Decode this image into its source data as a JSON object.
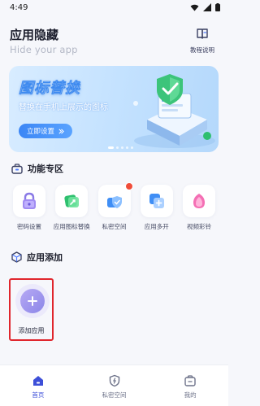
{
  "status_bar": {
    "time": "4:49"
  },
  "header": {
    "title": "应用隐藏",
    "subtitle": "Hide your app",
    "tutorial_label": "教程说明"
  },
  "banner": {
    "title": "图标替换",
    "description": "替换在手机上展示的图标",
    "button_label": "立即设置",
    "dot_count": 5,
    "active_dot": 0
  },
  "features_section": {
    "title": "功能专区",
    "items": [
      {
        "label": "密码设置",
        "icon": "lock-icon"
      },
      {
        "label": "应用图标替换",
        "icon": "image-icon"
      },
      {
        "label": "私密空间",
        "icon": "shield-icon",
        "badge": true
      },
      {
        "label": "应用多开",
        "icon": "plus-icon"
      },
      {
        "label": "视频彩铃",
        "icon": "bell-icon"
      }
    ]
  },
  "apps_section": {
    "title": "应用添加",
    "add_label": "添加应用"
  },
  "bottom_nav": [
    {
      "label": "首页",
      "icon": "home-icon",
      "active": true
    },
    {
      "label": "私密空间",
      "icon": "shield-icon",
      "active": false
    },
    {
      "label": "我的",
      "icon": "profile-icon",
      "active": false
    }
  ],
  "colors": {
    "accent": "#3d4fd8",
    "banner_button": "#3b86f5",
    "highlight_border": "#e0262d",
    "badge": "#f04d3a"
  }
}
